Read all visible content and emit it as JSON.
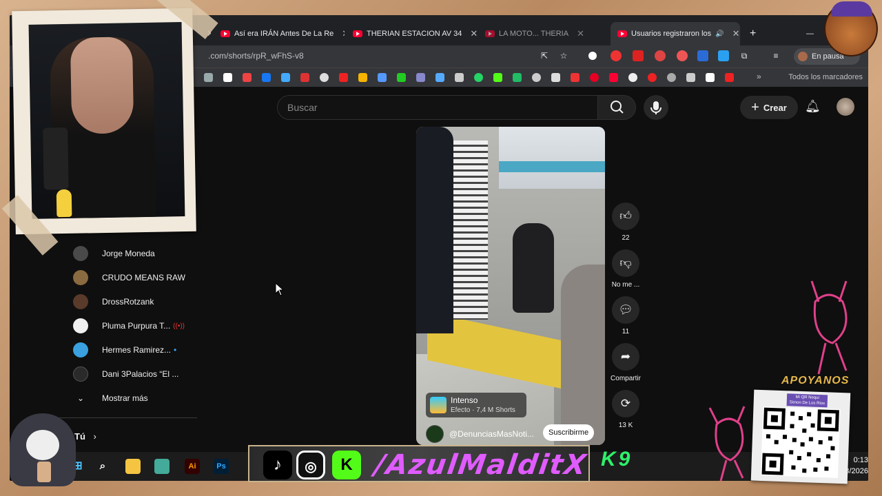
{
  "browser": {
    "tabs": [
      {
        "label": "Así era IRÁN Antes De La Re"
      },
      {
        "label": "THERIAN ESTACION AV 34"
      },
      {
        "label": "LA MOTO... THERIA"
      },
      {
        "label": "Usuarios registraron los"
      }
    ],
    "url": ".com/shorts/rpR_wFhS-v8",
    "bookmarks_all_label": "Todos los marcadores",
    "profile_label": "En pausa"
  },
  "youtube": {
    "search_placeholder": "Buscar",
    "create_label": "Crear",
    "subscriptions": [
      {
        "name": "Jorge Moneda",
        "color": "#4a4a4a"
      },
      {
        "name": "CRUDO MEANS RAW",
        "color": "#8a6a40"
      },
      {
        "name": "DrossRotzank",
        "color": "#5a3a2a"
      },
      {
        "name": "Pluma Purpura T...",
        "color": "#f0f0f0"
      },
      {
        "name": "Hermes Ramirez...",
        "color": "#3aa0e0"
      },
      {
        "name": "Dani 3Palacios “El ...",
        "color": "#2a2a2a"
      }
    ],
    "show_more_label": "Mostrar más",
    "you_label": "Tú",
    "short": {
      "effect_title": "Intenso",
      "effect_subtitle": "Efecto · 7,4 M Shorts",
      "channel": "@DenunciasMasNoti...",
      "subscribe_label": "Suscribirme",
      "likes": "22",
      "dislike_label": "No me ...",
      "comments": "11",
      "share_label": "Compartir",
      "remix_count": "13 K"
    }
  },
  "taskbar": {
    "time": "0:13",
    "date": "3/2026"
  },
  "overlay": {
    "handle": "/AzulMalditX",
    "k9": "K9",
    "support_title": "APOYANOS",
    "qr_caption_line1": "Mi QR Nequi",
    "qr_caption_line2": "Simon De Los Rios"
  }
}
